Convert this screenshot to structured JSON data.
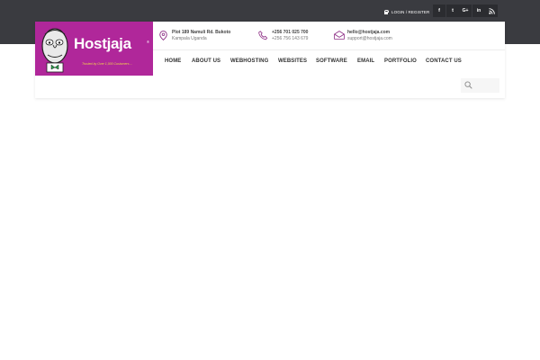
{
  "topbar": {
    "login_label": "LOGIN / REGISTER",
    "social": [
      {
        "icon": "facebook-icon",
        "glyph": "f"
      },
      {
        "icon": "twitter-icon",
        "glyph": "t"
      },
      {
        "icon": "google-plus-icon",
        "glyph": "G+"
      },
      {
        "icon": "linkedin-icon",
        "glyph": "in"
      },
      {
        "icon": "rss-icon",
        "glyph": "rss"
      }
    ]
  },
  "logo": {
    "name": "Hostjaja",
    "tagline": "Trusted by Over 1,000 Customers ..."
  },
  "contacts": {
    "address": {
      "line1": "Plot 189 Namuli Rd. Bukoto",
      "line2": "Kampala Uganda"
    },
    "phone": {
      "line1": "+256 701 025 700",
      "line2": "+256 756 143 679"
    },
    "email": {
      "line1": "hello@hostjaja.com",
      "line2": "support@hostjaja.com"
    }
  },
  "nav": {
    "items": [
      "HOME",
      "ABOUT US",
      "WEBHOSTING",
      "WEBSITES",
      "SOFTWARE",
      "EMAIL",
      "PORTFOLIO",
      "CONTACT US"
    ]
  },
  "search": {
    "placeholder": ""
  },
  "colors": {
    "topbar": "#3a3b40",
    "brand": "#b0279a",
    "accent": "#8e2f86"
  }
}
